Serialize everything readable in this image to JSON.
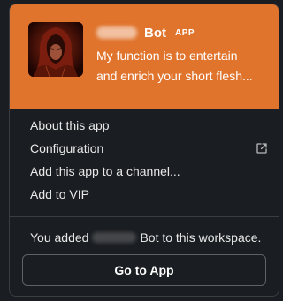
{
  "header": {
    "bot_name": "Bot",
    "badge": "APP",
    "description_line1": "My function is to entertain",
    "description_line2": "and enrich your short flesh...",
    "bg_color": "#e0742d"
  },
  "menu": {
    "items": [
      {
        "label": "About this app"
      },
      {
        "label": "Configuration",
        "icon": "external-link-icon"
      },
      {
        "label": "Add this app to a channel..."
      },
      {
        "label": "Add to VIP"
      }
    ]
  },
  "footer": {
    "added_prefix": "You added",
    "added_suffix": "Bot to this workspace.",
    "go_button_label": "Go to App"
  }
}
